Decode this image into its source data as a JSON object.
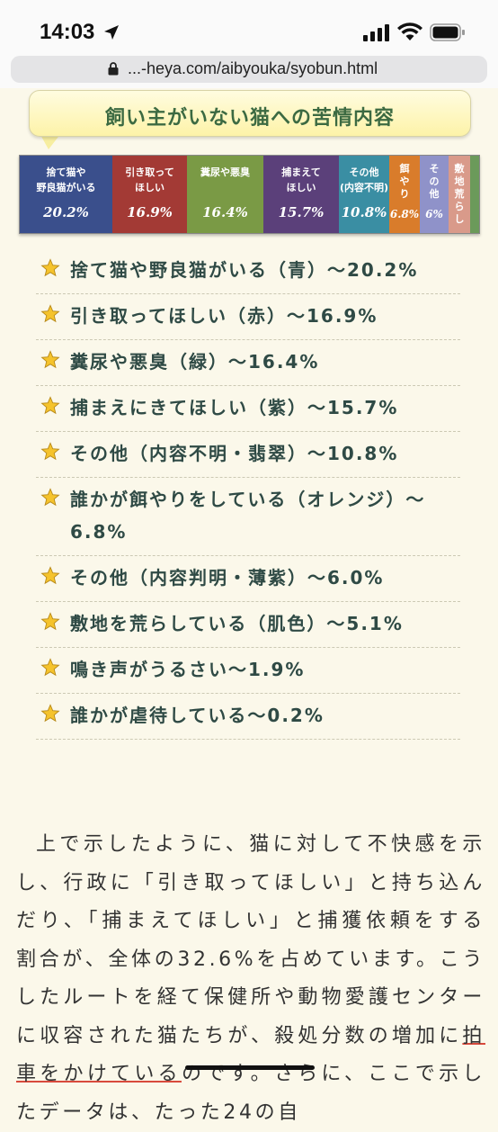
{
  "status_bar": {
    "time": "14:03"
  },
  "browser": {
    "url": "...-heya.com/aibyouka/syobun.html"
  },
  "title": "飼い主がいない猫への苦情内容",
  "chart_data": {
    "type": "bar",
    "categories": [
      "捨て猫や野良猫がいる",
      "引き取ってほしい",
      "糞尿や悪臭",
      "捕まえてほしい",
      "その他(内容不明)",
      "餌やり",
      "その他",
      "敷地荒らし"
    ],
    "values": [
      20.2,
      16.9,
      16.4,
      15.7,
      10.8,
      6.8,
      6.0,
      5.1
    ],
    "segments": [
      {
        "label_lines": [
          "捨て猫や",
          "野良猫がいる"
        ],
        "pct": "20.2%",
        "color": "#3a4f8c"
      },
      {
        "label_lines": [
          "引き取って",
          "ほしい"
        ],
        "pct": "16.9%",
        "color": "#a33a35"
      },
      {
        "label_lines": [
          "糞尿や悪臭"
        ],
        "pct": "16.4%",
        "color": "#7a9a45"
      },
      {
        "label_lines": [
          "捕まえて",
          "ほしい"
        ],
        "pct": "15.7%",
        "color": "#5b407a"
      },
      {
        "label_lines": [
          "その他",
          "(内容不明)"
        ],
        "pct": "10.8%",
        "color": "#3a8ea3"
      },
      {
        "label_lines": [
          "餌",
          "や",
          "り"
        ],
        "pct": "6.8%",
        "color": "#d97c2b"
      },
      {
        "label_lines": [
          "そ",
          "の",
          "他"
        ],
        "pct": "6%",
        "color": "#8f92c9"
      },
      {
        "label_lines": [
          "敷",
          "地",
          "荒",
          "ら",
          "し"
        ],
        "pct": "",
        "color": "#d99a8a"
      },
      {
        "label_lines": [],
        "pct": "",
        "color": "#6b9a5a"
      }
    ]
  },
  "list_items": [
    "捨て猫や野良猫がいる（青）〜20.2%",
    "引き取ってほしい（赤）〜16.9%",
    "糞尿や悪臭（緑）〜16.4%",
    "捕まえにきてほしい（紫）〜15.7%",
    "その他（内容不明・翡翠）〜10.8%",
    "誰かが餌やりをしている（オレンジ）〜6.8%",
    "その他（内容判明・薄紫）〜6.0%",
    "敷地を荒らしている（肌色）〜5.1%",
    "鳴き声がうるさい〜1.9%",
    "誰かが虐待している〜0.2%"
  ],
  "paragraph": {
    "part1": "上で示したように、猫に対して不快感を示し、行政に「引き取ってほしい」と持ち込んだり、「捕まえてほしい」と捕獲依頼をする割合が、全体の32.6%を占めています。こうしたルートを経て保健所や動物愛護センターに収容された猫たちが、殺処分数の増加に",
    "underlined": "拍車をかけている",
    "part2": "のです。さらに、ここで示したデータは、たった24の自"
  }
}
